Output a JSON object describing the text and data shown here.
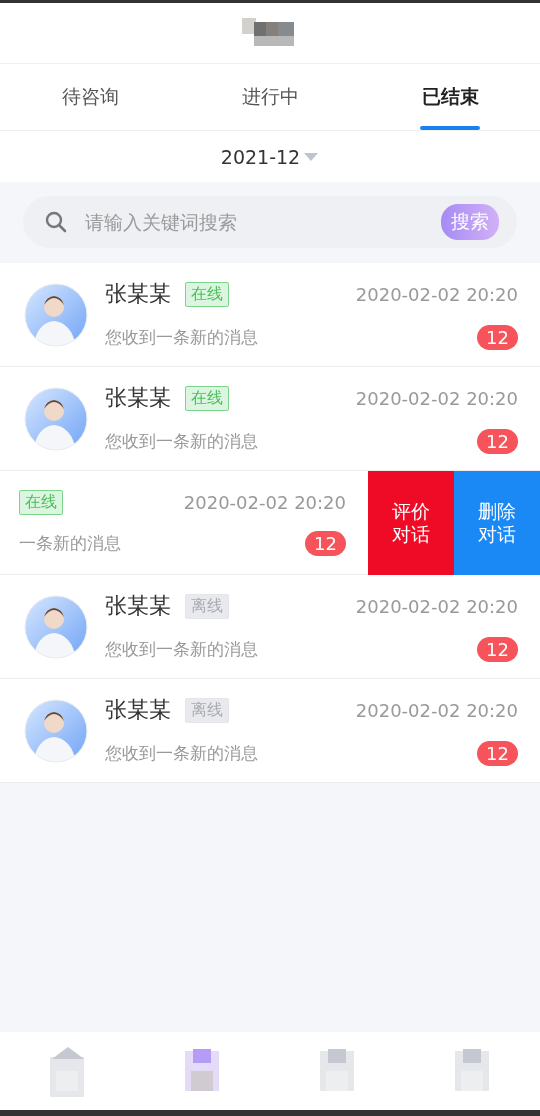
{
  "tabs": [
    {
      "label": "待咨询",
      "selected": false
    },
    {
      "label": "进行中",
      "selected": false
    },
    {
      "label": "已结束",
      "selected": true
    }
  ],
  "month": "2021-12",
  "search": {
    "placeholder": "请输入关键词搜索",
    "button": "搜索"
  },
  "conversations": [
    {
      "kind": "normal",
      "name": "张某某",
      "status": "在线",
      "online": true,
      "time": "2020-02-02 20:20",
      "message": "您收到一条新的消息",
      "count": "12"
    },
    {
      "kind": "normal",
      "name": "张某某",
      "status": "在线",
      "online": true,
      "time": "2020-02-02 20:20",
      "message": "您收到一条新的消息",
      "count": "12"
    },
    {
      "kind": "swiped",
      "status": "在线",
      "online": true,
      "time": "2020-02-02 20:20",
      "message": "一条新的消息",
      "count": "12",
      "actions": [
        {
          "label": "评价对话",
          "kind": "rate"
        },
        {
          "label": "删除对话",
          "kind": "delete"
        }
      ]
    },
    {
      "kind": "normal",
      "name": "张某某",
      "status": "离线",
      "online": false,
      "time": "2020-02-02 20:20",
      "message": "您收到一条新的消息",
      "count": "12"
    },
    {
      "kind": "normal",
      "name": "张某某",
      "status": "离线",
      "online": false,
      "time": "2020-02-02 20:20",
      "message": "您收到一条新的消息",
      "count": "12"
    }
  ],
  "nav": [
    {
      "selected": false
    },
    {
      "selected": true
    },
    {
      "selected": false
    },
    {
      "selected": false
    }
  ]
}
